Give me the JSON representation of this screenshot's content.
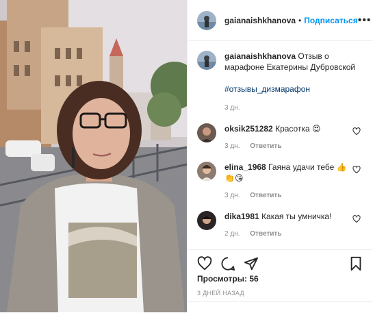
{
  "post": {
    "username": "gaianaishkhanova",
    "follow_label": "Подписаться",
    "separator": "•",
    "more_label": "•••"
  },
  "caption": {
    "username": "gaianaishkhanova",
    "text": "Отзыв о марафоне Екатерины Дубровской",
    "hashtag": "#отзывы_дизмарафон",
    "time": "3 дн."
  },
  "comments": [
    {
      "username": "oksik251282",
      "text": "Красотка",
      "emoji": "😍",
      "time": "3 дн.",
      "reply_label": "Ответить"
    },
    {
      "username": "elina_1968",
      "text": "Гаяна удачи тебе",
      "emoji": "👍",
      "emoji2": "👏😘",
      "time": "3 дн.",
      "reply_label": "Ответить"
    },
    {
      "username": "dika1981",
      "text": "Какая ты умничка!",
      "time": "2 дн.",
      "reply_label": "Ответить"
    }
  ],
  "stats": {
    "views_label": "Просмотры:",
    "views_count": "56",
    "posted_ago": "3 ДНЕЙ НАЗАД"
  },
  "colors": {
    "link_blue": "#0095f6",
    "hashtag": "#00376b",
    "muted": "#8e8e8e"
  },
  "icons": [
    "like-icon",
    "comment-icon",
    "share-icon",
    "save-icon",
    "heart-icon"
  ]
}
